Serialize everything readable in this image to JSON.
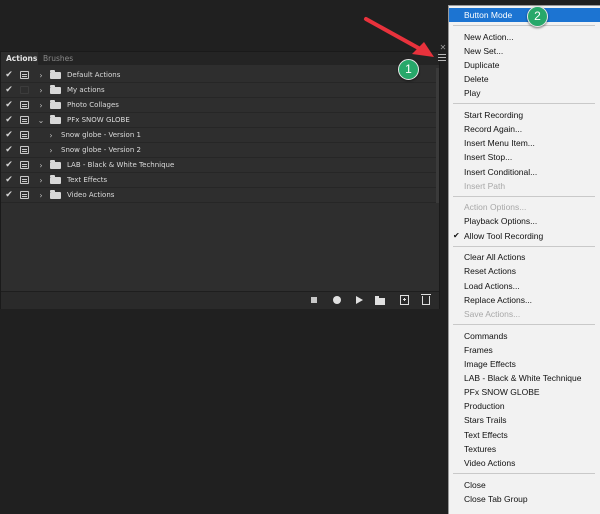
{
  "panel": {
    "tabs": [
      "Actions",
      "Brushes"
    ],
    "rows": [
      {
        "checked": true,
        "dialog": true,
        "level": 0,
        "expanded": false,
        "folder": true,
        "label": "Default Actions"
      },
      {
        "checked": true,
        "dialog": false,
        "level": 0,
        "expanded": false,
        "folder": true,
        "label": "My actions"
      },
      {
        "checked": true,
        "dialog": true,
        "level": 0,
        "expanded": false,
        "folder": true,
        "label": "Photo Collages"
      },
      {
        "checked": true,
        "dialog": true,
        "level": 0,
        "expanded": true,
        "folder": true,
        "label": "PFx SNOW GLOBE"
      },
      {
        "checked": true,
        "dialog": true,
        "level": 1,
        "expanded": false,
        "folder": false,
        "label": "Snow globe  - Version 1"
      },
      {
        "checked": true,
        "dialog": true,
        "level": 1,
        "expanded": false,
        "folder": false,
        "label": "Snow globe  - Version 2"
      },
      {
        "checked": true,
        "dialog": true,
        "level": 0,
        "expanded": false,
        "folder": true,
        "label": "LAB - Black & White Technique"
      },
      {
        "checked": true,
        "dialog": true,
        "level": 0,
        "expanded": false,
        "folder": true,
        "label": "Text Effects"
      },
      {
        "checked": true,
        "dialog": true,
        "level": 0,
        "expanded": false,
        "folder": true,
        "label": "Video Actions"
      }
    ],
    "footer_icons": [
      "stop-icon",
      "record-icon",
      "play-icon",
      "new-set-folder-icon",
      "new-action-icon",
      "delete-icon"
    ]
  },
  "menu": {
    "groups": [
      [
        {
          "label": "Button Mode",
          "highlighted": true
        }
      ],
      [
        {
          "label": "New Action..."
        },
        {
          "label": "New Set..."
        },
        {
          "label": "Duplicate"
        },
        {
          "label": "Delete"
        },
        {
          "label": "Play"
        }
      ],
      [
        {
          "label": "Start Recording"
        },
        {
          "label": "Record Again..."
        },
        {
          "label": "Insert Menu Item..."
        },
        {
          "label": "Insert Stop..."
        },
        {
          "label": "Insert Conditional..."
        },
        {
          "label": "Insert Path",
          "disabled": true
        }
      ],
      [
        {
          "label": "Action Options...",
          "disabled": true
        },
        {
          "label": "Playback Options..."
        },
        {
          "label": "Allow Tool Recording",
          "checked": true
        }
      ],
      [
        {
          "label": "Clear All Actions"
        },
        {
          "label": "Reset Actions"
        },
        {
          "label": "Load Actions..."
        },
        {
          "label": "Replace Actions..."
        },
        {
          "label": "Save Actions...",
          "disabled": true
        }
      ],
      [
        {
          "label": "Commands"
        },
        {
          "label": "Frames"
        },
        {
          "label": "Image Effects"
        },
        {
          "label": "LAB - Black & White Technique"
        },
        {
          "label": "PFx SNOW GLOBE"
        },
        {
          "label": "Production"
        },
        {
          "label": "Stars Trails"
        },
        {
          "label": "Text Effects"
        },
        {
          "label": "Textures"
        },
        {
          "label": "Video Actions"
        }
      ],
      [
        {
          "label": "Close"
        },
        {
          "label": "Close Tab Group"
        }
      ]
    ]
  },
  "annotations": {
    "badge_1": "1",
    "badge_2": "2",
    "badge_color": "#27a86a",
    "arrow_color": "#e8323c"
  },
  "colors": {
    "highlight": "#1c74d2",
    "panel_bg": "#2e2e2e",
    "menu_bg": "#f2f2f2"
  }
}
